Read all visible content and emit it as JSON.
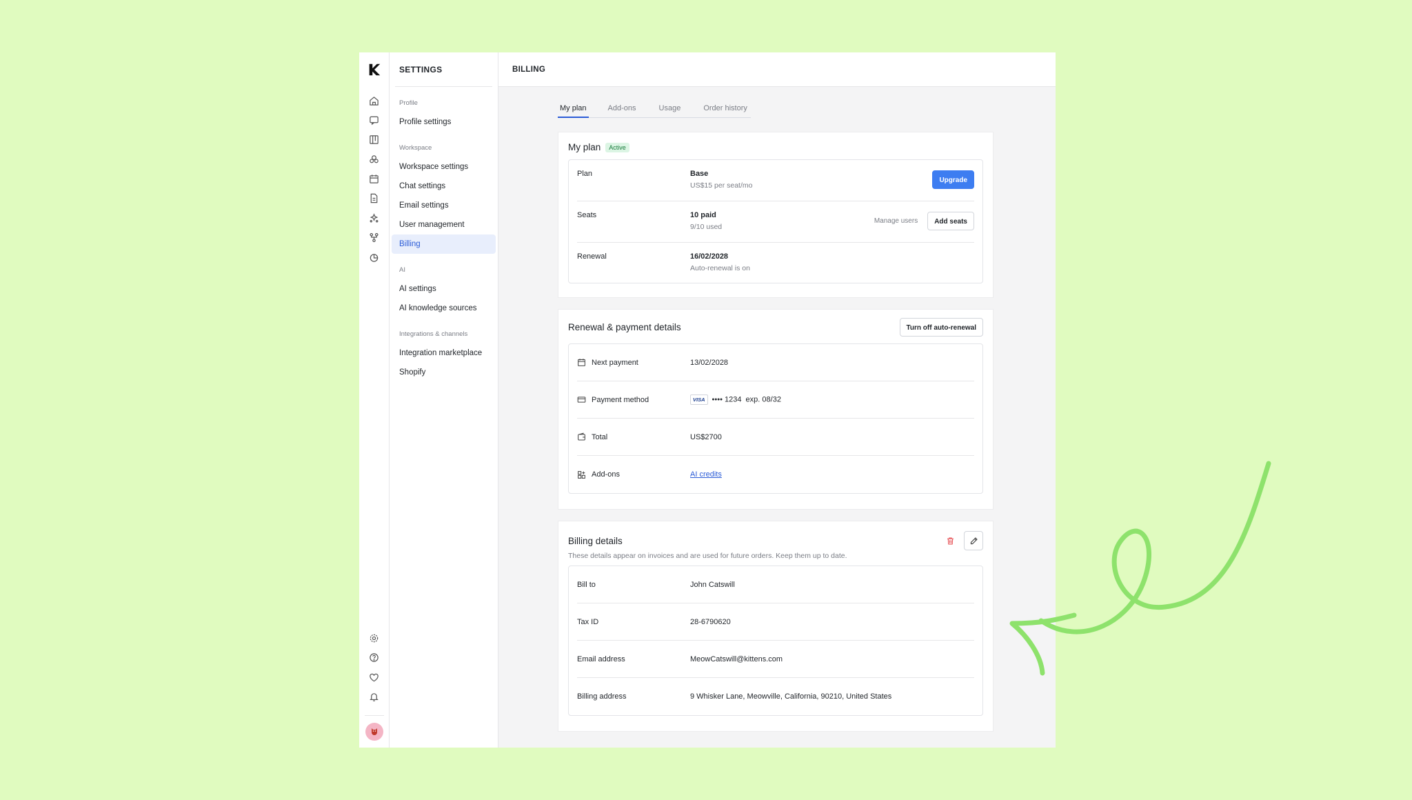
{
  "settings_title": "SETTINGS",
  "page_title": "BILLING",
  "nav": {
    "sections": [
      {
        "title": "Profile",
        "items": [
          "Profile settings"
        ]
      },
      {
        "title": "Workspace",
        "items": [
          "Workspace settings",
          "Chat settings",
          "Email settings",
          "User management",
          "Billing"
        ]
      },
      {
        "title": "AI",
        "items": [
          "AI settings",
          "AI knowledge sources"
        ]
      },
      {
        "title": "Integrations & channels",
        "items": [
          "Integration marketplace",
          "Shopify"
        ]
      }
    ],
    "active": "Billing"
  },
  "tabs": [
    "My plan",
    "Add-ons",
    "Usage",
    "Order history"
  ],
  "plan_card": {
    "title": "My plan",
    "badge": "Active",
    "plan_label": "Plan",
    "plan_value": "Base",
    "plan_sub": "US$15 per seat/mo",
    "upgrade": "Upgrade",
    "seats_label": "Seats",
    "seats_value": "10 paid",
    "seats_sub": "9/10 used",
    "manage_users": "Manage users",
    "add_seats": "Add seats",
    "renewal_label": "Renewal",
    "renewal_value": "16/02/2028",
    "renewal_sub": "Auto-renewal is on"
  },
  "payment_card": {
    "title": "Renewal & payment details",
    "turn_off": "Turn off auto-renewal",
    "next_payment_label": "Next payment",
    "next_payment_value": "13/02/2028",
    "method_label": "Payment method",
    "card_brand": "VISA",
    "card_value": "•••• 1234  exp. 08/32",
    "total_label": "Total",
    "total_value": "US$2700",
    "addons_label": "Add-ons",
    "addons_value": "AI credits"
  },
  "billing_card": {
    "title": "Billing details",
    "description": "These details appear on invoices and are used for future orders. Keep them up to date.",
    "bill_to_label": "Bill to",
    "bill_to_value": "John Catswill",
    "tax_label": "Tax ID",
    "tax_value": "28-6790620",
    "email_label": "Email address",
    "email_value": "MeowCatswill@kittens.com",
    "address_label": "Billing address",
    "address_value": "9 Whisker Lane, Meowville, California, 90210, United States"
  },
  "colors": {
    "background": "#e0fbbf",
    "accent": "#3d7df1",
    "arrow": "#8ee26c",
    "delete": "#e5484d"
  }
}
